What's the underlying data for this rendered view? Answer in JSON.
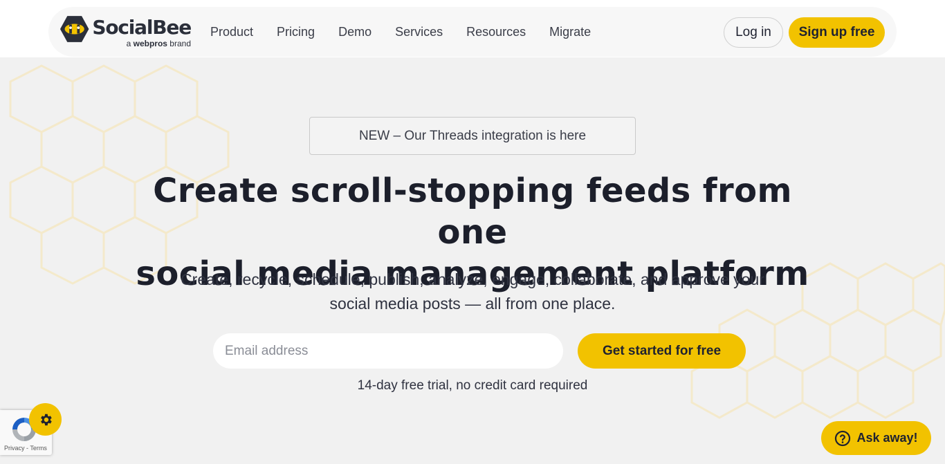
{
  "brand": {
    "name": "SocialBee",
    "tagline_prefix": "a",
    "tagline_brand": "webpros",
    "tagline_suffix": "brand",
    "accent_color": "#f2c200"
  },
  "nav": {
    "items": [
      {
        "label": "Product"
      },
      {
        "label": "Pricing"
      },
      {
        "label": "Demo"
      },
      {
        "label": "Services"
      },
      {
        "label": "Resources"
      },
      {
        "label": "Migrate"
      }
    ],
    "login_label": "Log in",
    "signup_label": "Sign up free"
  },
  "hero": {
    "announcement": "NEW – Our Threads integration is here",
    "headline_line1": "Create scroll-stopping feeds from one",
    "headline_line2": "social media management platform",
    "subtext_line1": "Create, recycle, schedule, publish, analyze, engage, collaborate, and approve your",
    "subtext_line2": "social media posts — all from one place.",
    "email_placeholder": "Email address",
    "cta_label": "Get started for free",
    "trial_note": "14-day free trial, no credit card required"
  },
  "widgets": {
    "recaptcha_links": "Privacy - Terms",
    "settings_icon": "gear-icon",
    "help_icon": "question-circle-icon",
    "help_label": "Ask away!"
  }
}
